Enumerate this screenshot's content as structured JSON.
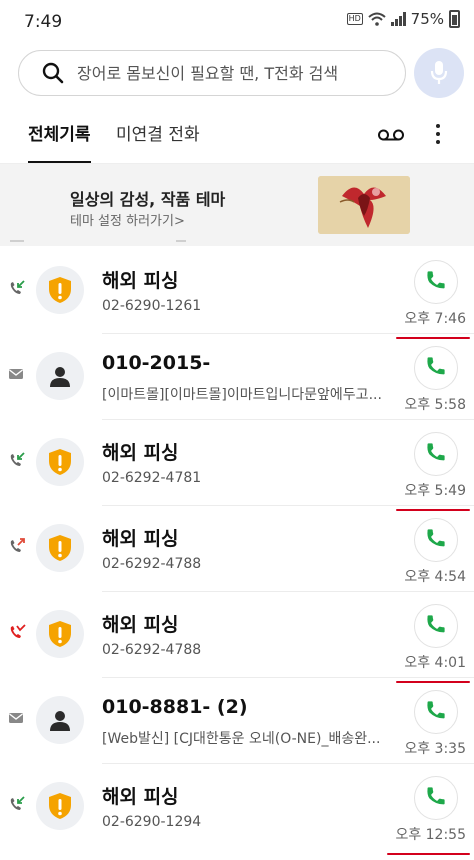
{
  "status_bar": {
    "time": "7:49",
    "hd_badge": "HD\nVoLTE",
    "battery": "75%"
  },
  "search": {
    "placeholder": "장어로 몸보신이 필요할 땐, T전화 검색"
  },
  "tabs": [
    {
      "label": "전체기록"
    },
    {
      "label": "미연결 전화"
    }
  ],
  "banner": {
    "title": "일상의 감성, 작품 테마",
    "link": "테마 설정 하러가기>"
  },
  "calls": [
    {
      "name": "해외 피싱",
      "detail": "02-6290-1261",
      "time": "오후 7:46",
      "avatar": "warning-shield-icon",
      "direction": "incoming-call-icon",
      "direction_color": "#2a9d4a",
      "underlined": true
    },
    {
      "name": "010-2015-",
      "detail": "[이마트몰][이마트몰]이마트입니다문앞에두고...",
      "time": "오후 5:58",
      "avatar": "person-icon",
      "direction": "message-icon",
      "direction_color": "#888888",
      "underlined": false
    },
    {
      "name": "해외 피싱",
      "detail": "02-6292-4781",
      "time": "오후 5:49",
      "avatar": "warning-shield-icon",
      "direction": "incoming-call-icon",
      "direction_color": "#2a9d4a",
      "underlined": true
    },
    {
      "name": "해외 피싱",
      "detail": "02-6292-4788",
      "time": "오후 4:54",
      "avatar": "warning-shield-icon",
      "direction": "outgoing-call-icon",
      "direction_color": "#e04b3a",
      "underlined": false
    },
    {
      "name": "해외 피싱",
      "detail": "02-6292-4788",
      "time": "오후 4:01",
      "avatar": "warning-shield-icon",
      "direction": "missed-call-icon",
      "direction_color": "#e02020",
      "underlined": true
    },
    {
      "name": "010-8881-          (2)",
      "detail": "[Web발신] [CJ대한통운 오네(O-NE)_배송완...",
      "time": "오후 3:35",
      "avatar": "person-icon",
      "direction": "message-icon",
      "direction_color": "#888888",
      "underlined": false
    },
    {
      "name": "해외 피싱",
      "detail": "02-6290-1294",
      "time": "오후 12:55",
      "avatar": "warning-shield-icon",
      "direction": "incoming-call-icon",
      "direction_color": "#2a9d4a",
      "underlined": true
    }
  ],
  "colors": {
    "accent_green": "#1ea84a",
    "warning_orange": "#f5a300",
    "underline_red": "#d3001c"
  }
}
